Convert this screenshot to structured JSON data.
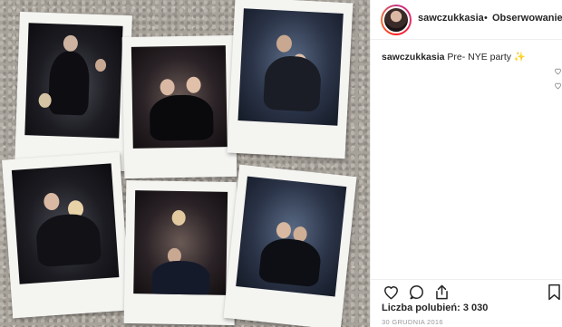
{
  "post": {
    "username": "sawczukkasia",
    "separator": "•",
    "follow_label": "Obserwowanie",
    "caption_user": "sawczukkasia",
    "caption_text": "Pre- NYE party",
    "caption_emoji": "✨",
    "likes_text": "Liczba polubień: 3 030",
    "date_text": "30 GRUDNIA 2016"
  },
  "icons": {
    "like": "heart-icon",
    "comment": "comment-icon",
    "share": "share-icon",
    "save": "bookmark-icon"
  },
  "colors": {
    "text": "#262626",
    "muted": "#8e8e8e",
    "border": "#efefef"
  }
}
